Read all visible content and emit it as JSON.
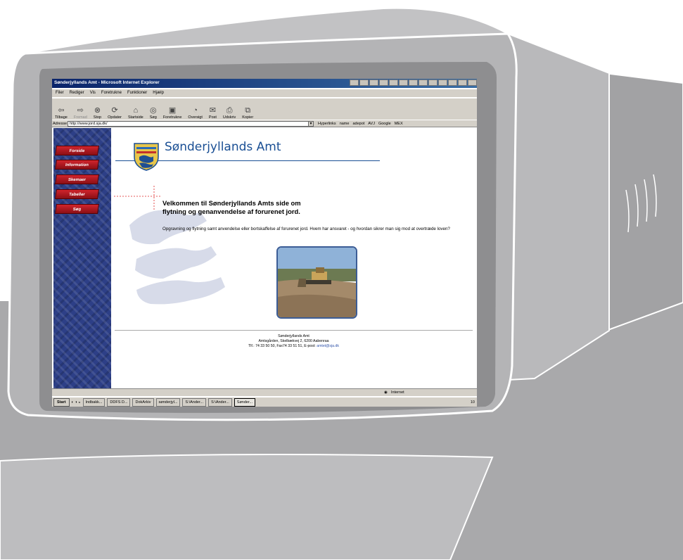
{
  "window": {
    "title": "Sønderjyllands Amt - Microsoft Internet Explorer"
  },
  "menu": [
    "Filer",
    "Rediger",
    "Vis",
    "Foretrukne",
    "Funktioner",
    "Hjælp"
  ],
  "toolbar": [
    {
      "label": "Tilbage",
      "icon": "back-arrow-icon",
      "disabled": false
    },
    {
      "label": "Fremad",
      "icon": "forward-arrow-icon",
      "disabled": true
    },
    {
      "label": "Stop",
      "icon": "stop-icon",
      "disabled": false
    },
    {
      "label": "Opdater",
      "icon": "refresh-icon",
      "disabled": false
    },
    {
      "label": "Startside",
      "icon": "home-icon",
      "disabled": false
    },
    {
      "label": "Søg",
      "icon": "search-icon",
      "disabled": false
    },
    {
      "label": "Foretrukne",
      "icon": "favorites-icon",
      "disabled": false
    },
    {
      "label": "Oversigt",
      "icon": "history-icon",
      "disabled": false
    },
    {
      "label": "Post",
      "icon": "mail-icon",
      "disabled": false
    },
    {
      "label": "Udskriv",
      "icon": "print-icon",
      "disabled": false
    },
    {
      "label": "Kopier",
      "icon": "copy-icon",
      "disabled": false
    }
  ],
  "address": {
    "label": "Adresse",
    "url": "http://www.jord.sja.dk/"
  },
  "links": {
    "label": "Hyperlinks",
    "items": [
      "name",
      "adepot",
      "AVJ",
      "Google",
      "MEX"
    ]
  },
  "page": {
    "site_title": "Sønderjyllands Amt",
    "nav": [
      "Forside",
      "Information",
      "Skemaer",
      "Tabeller",
      "Søg"
    ],
    "heading": "Velkommen til Sønderjyllands Amts side om\nflytning og genanvendelse af forurenet jord.",
    "intro": "Opgravning og flytning samt anvendelse eller bortskaffelse af forurenet jord. Hvem har ansvaret - og hvordan sikrer man sig mod at overtræde loven?",
    "footer": {
      "org": "Sønderjyllands Amt",
      "address": "Amtsgården, Skelbækvej 2, 6200 Aabenraa",
      "contact": "Tlf.: 74 33 50 50, Fax74 33 51 51, E-post: ",
      "email": "amtet@sja.dk"
    }
  },
  "status": {
    "zone": "Internet"
  },
  "taskbar": {
    "start": "Start",
    "tasks": [
      "Indbakk...",
      "DDFS D...",
      "DokArkiv",
      "sønderjyl...",
      "S:\\Ander...",
      "S:\\Ander...",
      "Sønder..."
    ],
    "active_index": 6,
    "clock": "10"
  },
  "colors": {
    "accent": "#1a4f94",
    "nav_red": "#c0191f",
    "sidebar_blue": "#2d3f87",
    "titlebar": "#0a246a"
  }
}
